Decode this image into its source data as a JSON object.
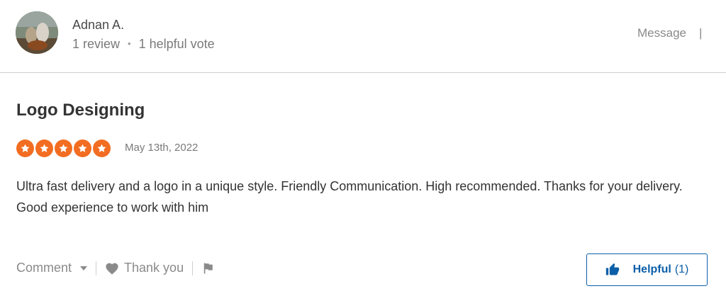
{
  "reviewer": {
    "name": "Adnan A.",
    "review_count": "1 review",
    "separator": "•",
    "helpful_votes": "1 helpful vote",
    "message_label": "Message",
    "divider": "|"
  },
  "review": {
    "title": "Logo Designing",
    "rating": 5,
    "rating_max": 5,
    "date": "May 13th, 2022",
    "body": "Ultra fast delivery and a logo in a unique style. Friendly Communication. High recommended. Thanks for your delivery. Good experience to work with him"
  },
  "actions": {
    "comment_label": "Comment",
    "thank_label": "Thank you",
    "helpful_label": "Helpful",
    "helpful_count": "(1)"
  },
  "icons": {
    "star": "star-icon",
    "caret": "chevron-down-icon",
    "heart": "heart-icon",
    "flag": "flag-icon",
    "thumb": "thumbs-up-icon"
  },
  "colors": {
    "star": "#f26d21",
    "helpful_accent": "#0b5fa8",
    "muted_text": "#8a8a8a",
    "body_text": "#333333"
  }
}
